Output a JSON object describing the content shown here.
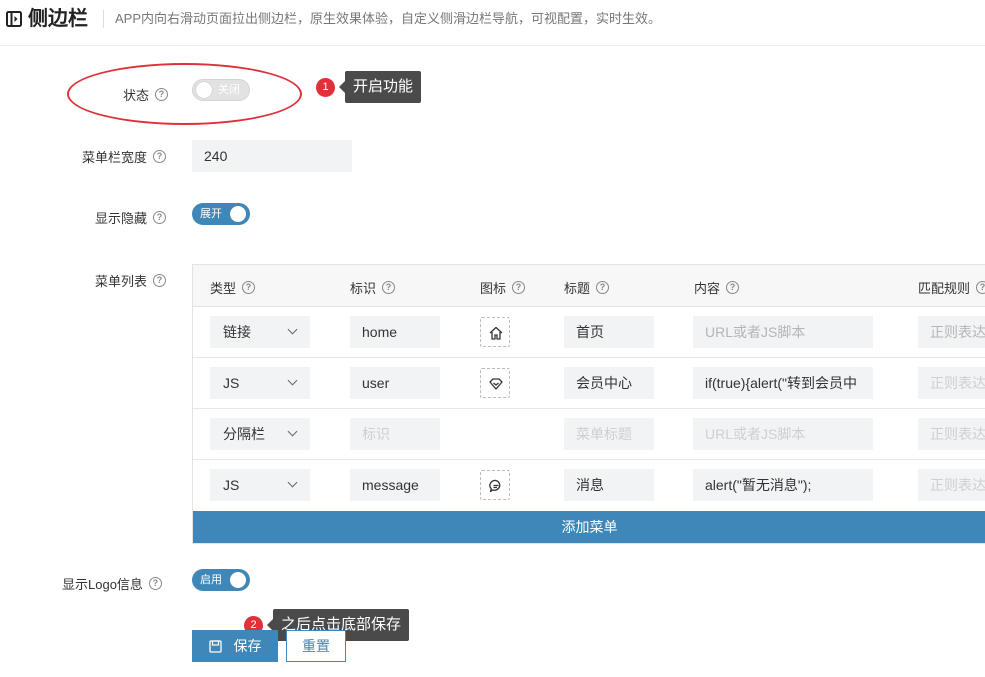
{
  "header": {
    "title": "侧边栏",
    "subtitle": "APP内向右滑动页面拉出侧边栏，原生效果体验，自定义侧滑边栏导航，可视配置，实时生效。"
  },
  "form": {
    "status_label": "状态",
    "status_toggle": "关闭",
    "width_label": "菜单栏宽度",
    "width_value": "240",
    "show_hide_label": "显示隐藏",
    "show_hide_toggle": "展开",
    "menu_list_label": "菜单列表",
    "logo_label": "显示Logo信息",
    "logo_toggle": "启用"
  },
  "annotations": {
    "step1_num": "1",
    "step1_text": "开启功能",
    "step2_num": "2",
    "step2_text": "之后点击底部保存"
  },
  "table": {
    "headers": {
      "type": "类型",
      "id": "标识",
      "icon": "图标",
      "title": "标题",
      "content": "内容",
      "rule": "匹配规则"
    },
    "rows": [
      {
        "type": "链接",
        "id": "home",
        "id_placeholder": false,
        "icon": "home-icon",
        "title": "首页",
        "title_placeholder": false,
        "content": "URL或者JS脚本",
        "content_placeholder": true,
        "rule": "正则表达"
      },
      {
        "type": "JS",
        "id": "user",
        "id_placeholder": false,
        "icon": "diamond-icon",
        "title": "会员中心",
        "title_placeholder": false,
        "content": "if(true){alert(\"转到会员中",
        "content_placeholder": false,
        "rule": "正则表达"
      },
      {
        "type": "分隔栏",
        "id": "标识",
        "id_placeholder": true,
        "icon": "",
        "title": "菜单标题",
        "title_placeholder": true,
        "content": "URL或者JS脚本",
        "content_placeholder": true,
        "rule": "正则表达"
      },
      {
        "type": "JS",
        "id": "message",
        "id_placeholder": false,
        "icon": "chat-icon",
        "title": "消息",
        "title_placeholder": false,
        "content": "alert(\"暂无消息\");",
        "content_placeholder": false,
        "rule": "正则表达"
      }
    ],
    "add_button": "添加菜单"
  },
  "buttons": {
    "save": "保存",
    "reset": "重置"
  },
  "colors": {
    "accent": "#3f87b8",
    "annotation_red": "#e0303a",
    "tooltip_bg": "#4a4a4a"
  }
}
